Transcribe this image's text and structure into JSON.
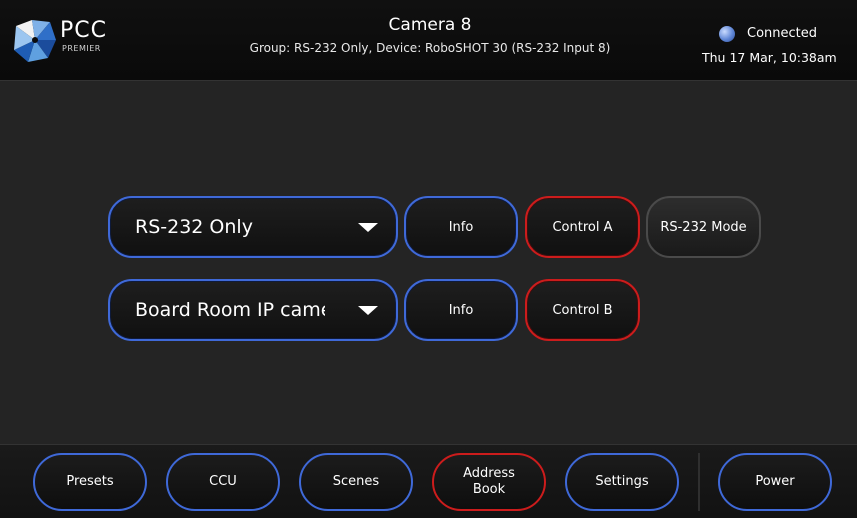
{
  "header": {
    "logo_text": "PCC",
    "logo_sub": "PREMIER",
    "title": "Camera 8",
    "subtitle": "Group: RS-232 Only,  Device: RoboSHOT 30 (RS-232 Input 8)",
    "status": "Connected",
    "datetime": "Thu 17 Mar, 10:38am"
  },
  "controls": {
    "row1": {
      "dropdown_value": "RS-232 Only",
      "info_label": "Info",
      "control_label": "Control A",
      "mode_label": "RS-232 Mode"
    },
    "row2": {
      "dropdown_value": "Board Room IP camera",
      "info_label": "Info",
      "control_label": "Control B"
    }
  },
  "nav": {
    "presets": "Presets",
    "ccu": "CCU",
    "scenes": "Scenes",
    "address_book_line1": "Address",
    "address_book_line2": "Book",
    "settings": "Settings",
    "power": "Power"
  },
  "colors": {
    "accent_blue": "#3f69d8",
    "accent_red": "#cc1c1c",
    "background": "#242424"
  },
  "icons": {
    "logo": "pcc-logo-icon",
    "status": "connection-status-icon",
    "dropdown": "chevron-down-icon"
  }
}
